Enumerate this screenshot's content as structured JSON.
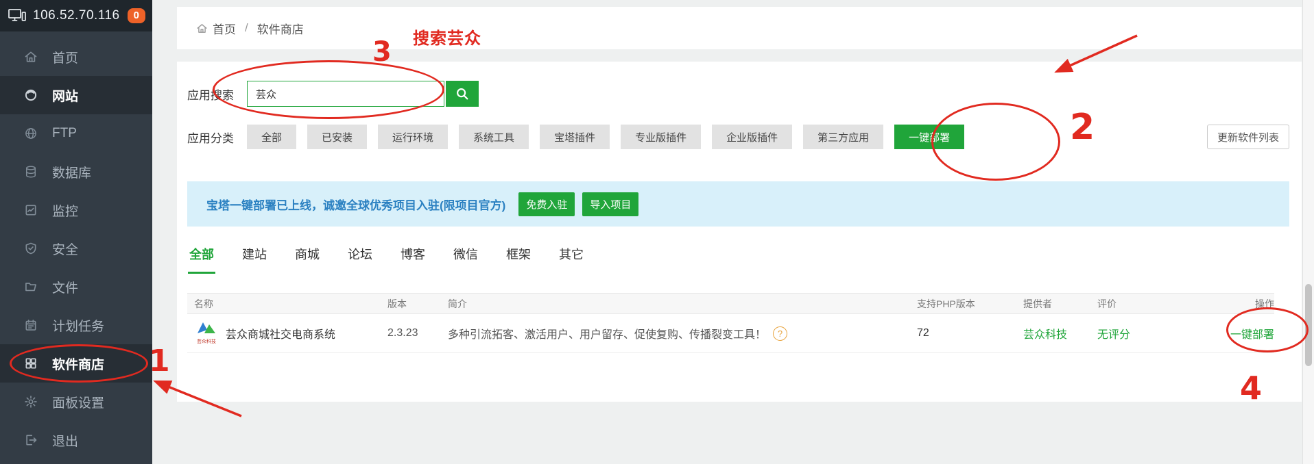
{
  "sidebar": {
    "server_ip": "106.52.70.116",
    "badge_count": "0",
    "items": [
      {
        "label": "首页",
        "icon": "home-icon",
        "active": false
      },
      {
        "label": "网站",
        "icon": "website-icon",
        "active": true
      },
      {
        "label": "FTP",
        "icon": "ftp-icon",
        "active": false
      },
      {
        "label": "数据库",
        "icon": "database-icon",
        "active": false
      },
      {
        "label": "监控",
        "icon": "monitor-icon",
        "active": false
      },
      {
        "label": "安全",
        "icon": "security-icon",
        "active": false
      },
      {
        "label": "文件",
        "icon": "folder-icon",
        "active": false
      },
      {
        "label": "计划任务",
        "icon": "calendar-icon",
        "active": false
      },
      {
        "label": "软件商店",
        "icon": "appstore-icon",
        "active": true
      },
      {
        "label": "面板设置",
        "icon": "gear-icon",
        "active": false
      },
      {
        "label": "退出",
        "icon": "logout-icon",
        "active": false
      }
    ]
  },
  "breadcrumb": {
    "home": "首页",
    "separator": "/",
    "current": "软件商店"
  },
  "search": {
    "label": "应用搜索",
    "value": "芸众",
    "button_icon": "search-icon"
  },
  "categories": {
    "label": "应用分类",
    "items": [
      "全部",
      "已安装",
      "运行环境",
      "系统工具",
      "宝塔插件",
      "专业版插件",
      "企业版插件",
      "第三方应用",
      "一键部署"
    ],
    "active": "一键部署",
    "update_button": "更新软件列表"
  },
  "banner": {
    "text": "宝塔一键部署已上线，诚邀全球优秀项目入驻(限项目官方)",
    "buttons": [
      "免费入驻",
      "导入项目"
    ]
  },
  "tabs": {
    "items": [
      "全部",
      "建站",
      "商城",
      "论坛",
      "博客",
      "微信",
      "框架",
      "其它"
    ],
    "active": "全部"
  },
  "table": {
    "headers": [
      "名称",
      "版本",
      "简介",
      "支持PHP版本",
      "提供者",
      "评价",
      "操作"
    ],
    "rows": [
      {
        "name": "芸众商城社交电商系统",
        "logo_icon": "yunzhong-logo-icon",
        "logo_text": "芸众科技",
        "version": "2.3.23",
        "description": "多种引流拓客、激活用户、用户留存、促使复购、传播裂变工具！",
        "help_icon": "?",
        "php_version": "72",
        "provider": "芸众科技",
        "rating": "无评分",
        "action": "一键部署"
      }
    ]
  },
  "annotations": {
    "step1": "1",
    "step2": "2",
    "step3": "3",
    "step4": "4",
    "search_hint": "搜索芸众"
  },
  "colors": {
    "accent_green": "#20a53a",
    "badge_orange": "#ee6228",
    "annotation_red": "#e12a20",
    "banner_text_blue": "#2a80c1",
    "banner_bg": "#d8f0fa",
    "sidebar_bg": "#333c45",
    "sidebar_header_bg": "#1f262c"
  }
}
